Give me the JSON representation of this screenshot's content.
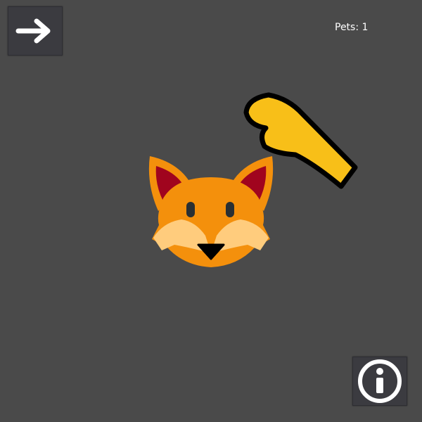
{
  "game": {
    "pets_label": "Pets:",
    "pets_count": "1"
  },
  "buttons": {
    "next": {
      "icon": "right-arrow-icon"
    },
    "info": {
      "icon": "info-icon"
    }
  },
  "character": {
    "name": "fox",
    "colors": {
      "fur": "#f4900c",
      "ear_inner": "#a0041e",
      "cheek": "#ffcc7d",
      "eyes": "#292f33"
    }
  },
  "cursor": {
    "icon": "petting-hand-icon",
    "fill": "#f8bf18",
    "outline": "#000000"
  },
  "colors": {
    "background": "#4a4a4a",
    "button_bg": "#3b3b40",
    "text": "#ffffff"
  }
}
